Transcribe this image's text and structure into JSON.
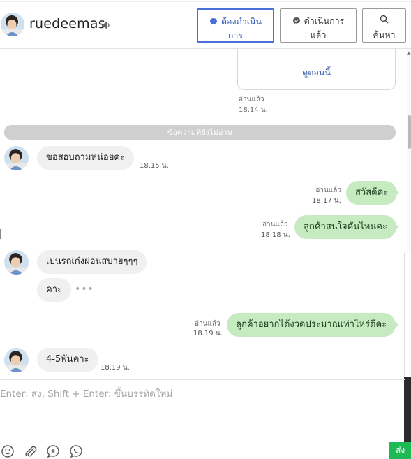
{
  "header": {
    "username": "ruedeemas",
    "buttons": {
      "todo": {
        "line1": "ต้องดำเนิน",
        "line2": "การ"
      },
      "done": {
        "line1": "ดำเนินการ",
        "line2": "แล้ว"
      },
      "search": {
        "label": "ค้นหา"
      }
    }
  },
  "card": {
    "link_label": "ดูตอนนี้",
    "read": "อ่านแล้ว",
    "time": "18.14 น."
  },
  "unread_divider": "ข้อความที่ยังไม่อ่าน",
  "messages": [
    {
      "side": "in",
      "text": "ขอสอบถามหน่อยค่ะ",
      "time": "18.15 น."
    },
    {
      "side": "out",
      "text": "สวัสดีคะ",
      "read": "อ่านแล้ว",
      "time": "18.17 น."
    },
    {
      "side": "out",
      "text": "ลูกค้าสนใจคันไหนคะ",
      "read": "อ่านแล้ว",
      "time": "18.18 น."
    },
    {
      "side": "in",
      "text": "เปนรถเก๋งผ่อนสบายๆๆๆ"
    },
    {
      "side": "in",
      "text": "คาะ",
      "more": "•••"
    },
    {
      "side": "out",
      "text": "ลูกค้าอยากได้งวดประมาณเท่าไหร่ดีคะ",
      "read": "อ่านแล้ว",
      "time": "18.19 น."
    },
    {
      "side": "in",
      "text": "4-5พันคาะ",
      "time": "18.19 น."
    }
  ],
  "composer": {
    "placeholder": "Enter: ส่ง, Shift + Enter: ขึ้นบรรทัดใหม่",
    "send_label": "ส่ง"
  },
  "colors": {
    "accent": "#4a6fd6",
    "outgoing_bubble": "#c6ebc0",
    "incoming_bubble": "#f0f0f0",
    "send_button": "#1db954"
  }
}
